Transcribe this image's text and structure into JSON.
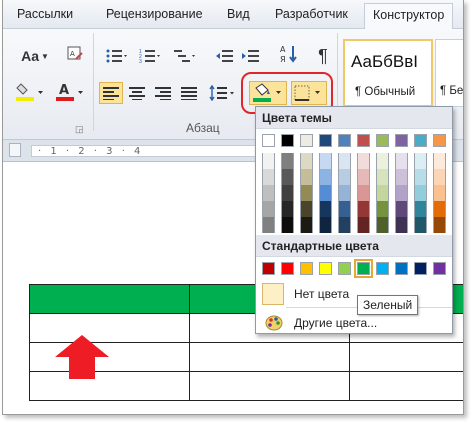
{
  "tabs": [
    "Рассылки",
    "Рецензирование",
    "Вид",
    "Разработчик",
    "Конструктор"
  ],
  "ribbon": {
    "aa_label": "Aa",
    "group_paragraph_label": "Абзац",
    "pilcrow": "¶",
    "style1_sample": "АаБбВвІ",
    "style1_name": "¶ Обычный",
    "style2_name": "¶ Бе"
  },
  "ruler": {
    "ticks": "· 1 · 2 · 3 · 4"
  },
  "dropdown": {
    "theme_header": "Цвета темы",
    "standard_header": "Стандартные цвета",
    "no_color": "Нет цвета",
    "other_colors": "Другие цвета...",
    "tooltip": "Зеленый",
    "theme_colors": [
      [
        "#ffffff",
        "#f2f2f2",
        "#d9d9d9",
        "#bfbfbf",
        "#a6a6a6",
        "#808080"
      ],
      [
        "#000000",
        "#7f7f7f",
        "#595959",
        "#404040",
        "#262626",
        "#0d0d0d"
      ],
      [
        "#eeece1",
        "#ddd9c3",
        "#c4bd97",
        "#948a54",
        "#4a452a",
        "#1d1b10"
      ],
      [
        "#1f497d",
        "#c6d9f0",
        "#8db3e2",
        "#548dd4",
        "#17365d",
        "#0f243e"
      ],
      [
        "#4f81bd",
        "#dbe5f1",
        "#b8cce4",
        "#95b3d7",
        "#366092",
        "#244061"
      ],
      [
        "#c0504d",
        "#f2dcdb",
        "#e5b9b7",
        "#d99694",
        "#953734",
        "#632423"
      ],
      [
        "#9bbb59",
        "#ebf1dd",
        "#d7e3bc",
        "#c3d69b",
        "#76923c",
        "#4f6128"
      ],
      [
        "#8064a2",
        "#e5e0ec",
        "#ccc1d9",
        "#b2a2c7",
        "#5f497a",
        "#3f3151"
      ],
      [
        "#4bacc6",
        "#dbeef3",
        "#b7dde8",
        "#92cddc",
        "#31859b",
        "#205867"
      ],
      [
        "#f79646",
        "#fdeada",
        "#fbd5b5",
        "#fac08f",
        "#e36c09",
        "#974806"
      ]
    ],
    "standard_colors": [
      "#c00000",
      "#ff0000",
      "#ffc000",
      "#ffff00",
      "#92d050",
      "#00b050",
      "#00b0f0",
      "#0070c0",
      "#002060",
      "#7030a0"
    ]
  },
  "table": {
    "header_color": "#00b050"
  }
}
